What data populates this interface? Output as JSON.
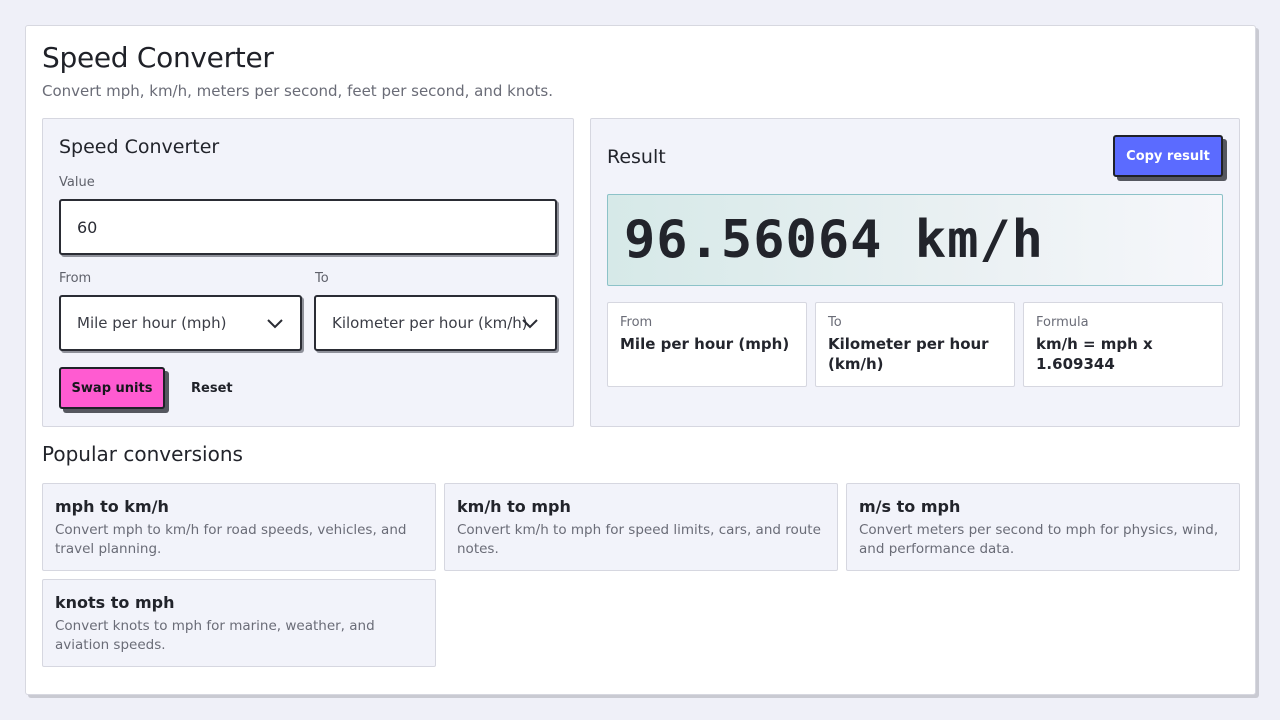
{
  "header": {
    "title": "Speed Converter",
    "subtitle": "Convert mph, km/h, meters per second, feet per second, and knots."
  },
  "converter": {
    "title": "Speed Converter",
    "value_label": "Value",
    "value": "60",
    "from_label": "From",
    "to_label": "To",
    "from_selected": "Mile per hour (mph)",
    "to_selected": "Kilometer per hour (km/h)",
    "swap_label": "Swap units",
    "reset_label": "Reset"
  },
  "result": {
    "title": "Result",
    "copy_label": "Copy result",
    "value": "96.56064 km/h",
    "from_key": "From",
    "from_value": "Mile per hour (mph)",
    "to_key": "To",
    "to_value": "Kilometer per hour (km/h)",
    "formula_key": "Formula",
    "formula_value": "km/h = mph x 1.609344"
  },
  "popular": {
    "title": "Popular conversions",
    "items": [
      {
        "title": "mph to km/h",
        "desc": "Convert mph to km/h for road speeds, vehicles, and travel planning."
      },
      {
        "title": "km/h to mph",
        "desc": "Convert km/h to mph for speed limits, cars, and route notes."
      },
      {
        "title": "m/s to mph",
        "desc": "Convert meters per second to mph for physics, wind, and performance data."
      },
      {
        "title": "knots to mph",
        "desc": "Convert knots to mph for marine, weather, and aviation speeds."
      }
    ]
  },
  "colors": {
    "swap_button": "#ff5bd1",
    "copy_button": "#5b6bff",
    "result_border": "#8cc2c8"
  },
  "icons": [
    "chevron-down-icon"
  ]
}
